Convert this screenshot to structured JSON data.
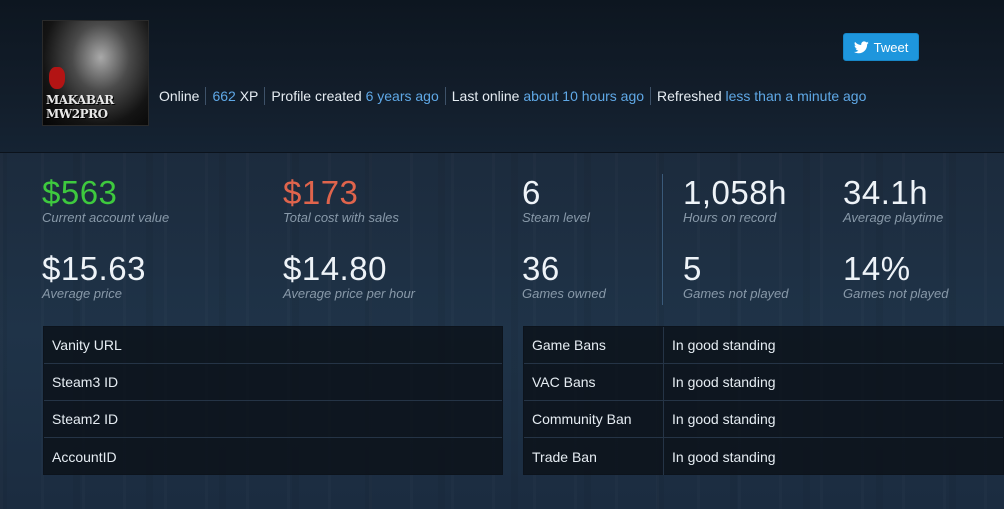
{
  "avatar": {
    "text_line1": "MAKABAR",
    "text_line2": "MW2PRO"
  },
  "status": {
    "online": "Online",
    "xp_value": "662",
    "xp_unit": "XP",
    "profile_created_label": "Profile created",
    "profile_created_value": "6 years ago",
    "last_online_label": "Last online",
    "last_online_value": "about 10 hours ago",
    "refreshed_label": "Refreshed",
    "refreshed_value": "less than a minute ago"
  },
  "tweet": {
    "label": "Tweet",
    "icon": "twitter-bird-icon"
  },
  "stats": {
    "account_value": {
      "value": "$563",
      "label": "Current account value"
    },
    "total_cost": {
      "value": "$173",
      "label": "Total cost with sales"
    },
    "steam_level": {
      "value": "6",
      "label": "Steam level"
    },
    "hours_on_record": {
      "value": "1,058h",
      "label": "Hours on record"
    },
    "average_playtime": {
      "value": "34.1h",
      "label": "Average playtime"
    },
    "average_price": {
      "value": "$15.63",
      "label": "Average price"
    },
    "average_price_per_hour": {
      "value": "$14.80",
      "label": "Average price per hour"
    },
    "games_owned": {
      "value": "36",
      "label": "Games owned"
    },
    "games_not_played_count": {
      "value": "5",
      "label": "Games not played"
    },
    "games_not_played_pct": {
      "value": "14%",
      "label": "Games not played"
    }
  },
  "ids_table": {
    "rows": [
      {
        "key": "Vanity URL"
      },
      {
        "key": "Steam3 ID"
      },
      {
        "key": "Steam2 ID"
      },
      {
        "key": "AccountID"
      }
    ]
  },
  "bans_table": {
    "rows": [
      {
        "key": "Game Bans",
        "value": "In good standing"
      },
      {
        "key": "VAC Bans",
        "value": "In good standing"
      },
      {
        "key": "Community Ban",
        "value": "In good standing"
      },
      {
        "key": "Trade Ban",
        "value": "In good standing"
      }
    ]
  },
  "colors": {
    "positive": "#3ec93e",
    "negative": "#e0644c",
    "link": "#5fa8e6",
    "tweet_bg": "#1e96dd"
  }
}
